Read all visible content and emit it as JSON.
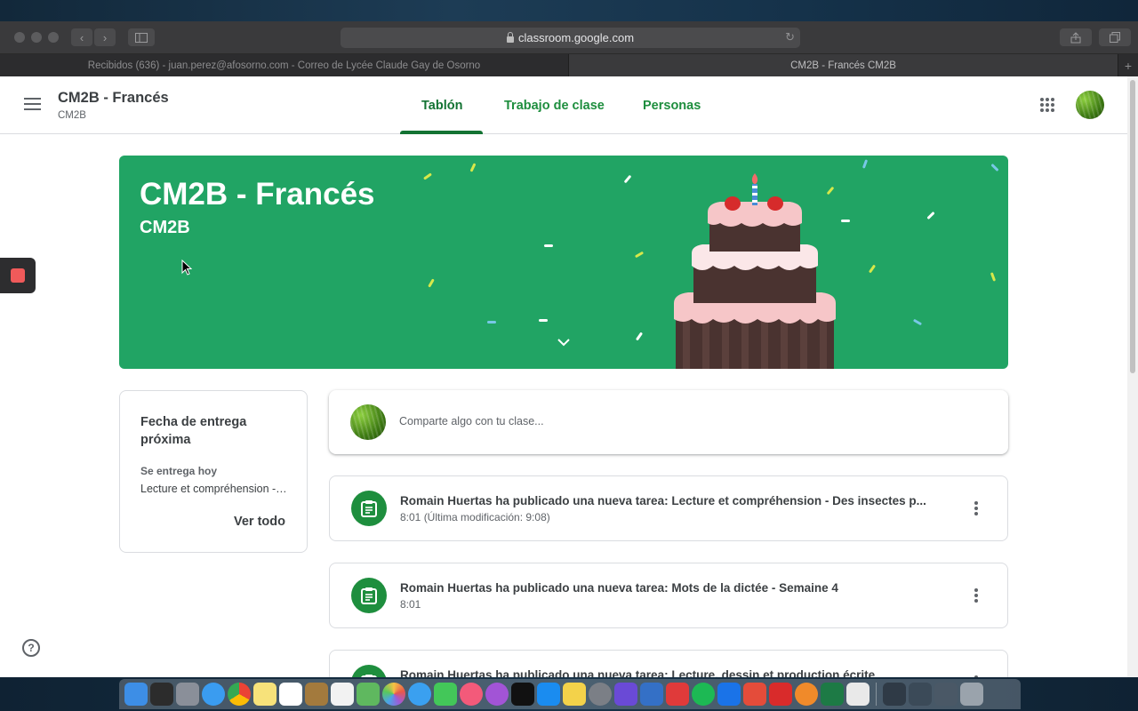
{
  "browser": {
    "url": "classroom.google.com",
    "tabs": [
      {
        "label": "Recibidos (636) - juan.perez@afosorno.com - Correo de Lycée Claude Gay de Osorno"
      },
      {
        "label": "CM2B - Francés CM2B"
      }
    ]
  },
  "header": {
    "class_name": "CM2B - Francés",
    "section": "CM2B",
    "tabs": [
      {
        "label": "Tablón",
        "active": true
      },
      {
        "label": "Trabajo de clase"
      },
      {
        "label": "Personas"
      }
    ]
  },
  "banner": {
    "title": "CM2B - Francés",
    "subtitle": "CM2B",
    "color": "#21a464"
  },
  "upcoming": {
    "title": "Fecha de entrega próxima",
    "due_label": "Se entrega hoy",
    "item": "Lecture et compréhension - Des insectes p...",
    "view_all": "Ver todo"
  },
  "share": {
    "placeholder": "Comparte algo con tu clase..."
  },
  "posts": [
    {
      "title": "Romain Huertas ha publicado una nueva tarea: Lecture et compréhension - Des insectes p...",
      "time": "8:01 (Última modificación: 9:08)"
    },
    {
      "title": "Romain Huertas ha publicado una nueva tarea: Mots de la dictée - Semaine 4",
      "time": "8:01"
    },
    {
      "title": "Romain Huertas ha publicado una nueva tarea: Lecture, dessin et production écrite",
      "time": ""
    }
  ],
  "help": {
    "label": "?"
  },
  "colors": {
    "accent": "#1e8e3e",
    "accent_dark": "#137333"
  }
}
